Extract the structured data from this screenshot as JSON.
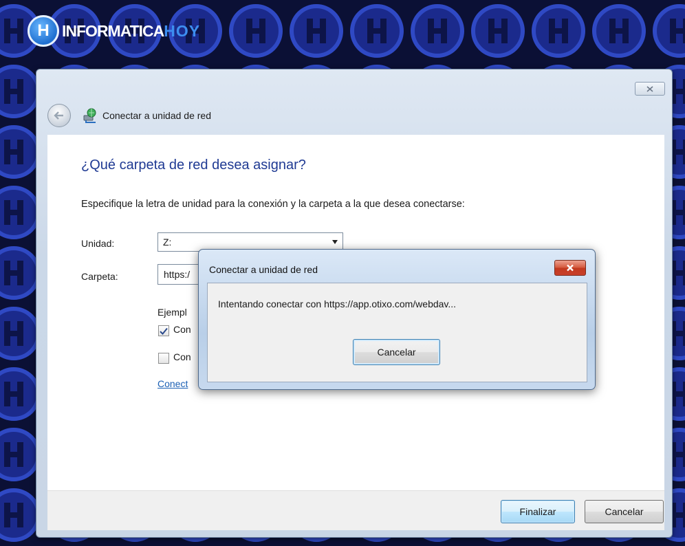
{
  "brand": {
    "logo_letter": "H",
    "name_part1": "INFORMATICA",
    "name_part2": "HOY"
  },
  "window": {
    "header_title": "Conectar a unidad de red",
    "heading": "¿Qué carpeta de red desea asignar?",
    "description": "Especifique la letra de unidad para la conexión y la carpeta a la que desea conectarse:",
    "drive": {
      "label": "Unidad:",
      "value": "Z:"
    },
    "folder": {
      "label": "Carpeta:",
      "value": "https:/"
    },
    "example_text": "Ejempl",
    "checkbox_1": {
      "label": "Con",
      "checked": true
    },
    "checkbox_2": {
      "label": "Con",
      "checked": false
    },
    "link_text": "Conect",
    "finish_button": "Finalizar",
    "cancel_button": "Cancelar"
  },
  "dialog": {
    "title": "Conectar a unidad de red",
    "message": "Intentando conectar con https://app.otixo.com/webdav...",
    "cancel_button": "Cancelar"
  },
  "icons": {
    "window_close": "close-icon",
    "back": "back-arrow-icon",
    "network": "network-drive-icon",
    "dropdown": "chevron-down-icon",
    "check": "checkmark-icon",
    "dialog_close": "close-icon"
  },
  "colors": {
    "background": "#0b1035",
    "heading": "#1f3a93",
    "link": "#1a5fb4",
    "close_red": "#c8402a"
  }
}
